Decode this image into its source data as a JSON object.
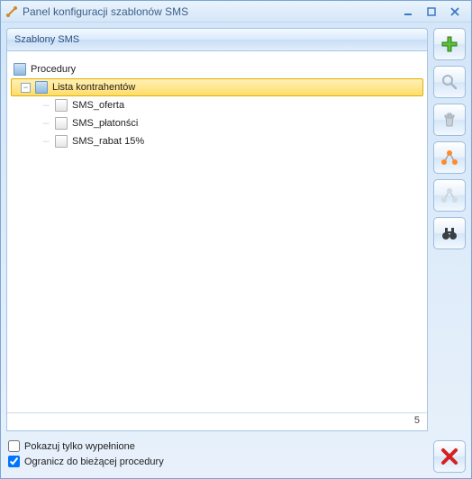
{
  "window": {
    "title": "Panel konfiguracji szablonów SMS"
  },
  "panel": {
    "title": "Szablony SMS"
  },
  "tree": {
    "root": "Procedury",
    "selected": "Lista kontrahentów",
    "items": [
      {
        "label": "SMS_oferta"
      },
      {
        "label": "SMS_płatonści"
      },
      {
        "label": "SMS_rabat 15%"
      }
    ],
    "count": "5"
  },
  "checks": {
    "show_only_filled": "Pokazuj tylko wypełnione",
    "limit_current_procedure": "Ogranicz do bieżącej procedury"
  },
  "toolbar": {
    "add": "plus-icon",
    "find": "magnifier-icon",
    "delete": "trash-icon",
    "share": "nodes-icon",
    "share2": "nodes-grey-icon",
    "binoculars": "binoculars-icon",
    "close": "close-icon"
  }
}
